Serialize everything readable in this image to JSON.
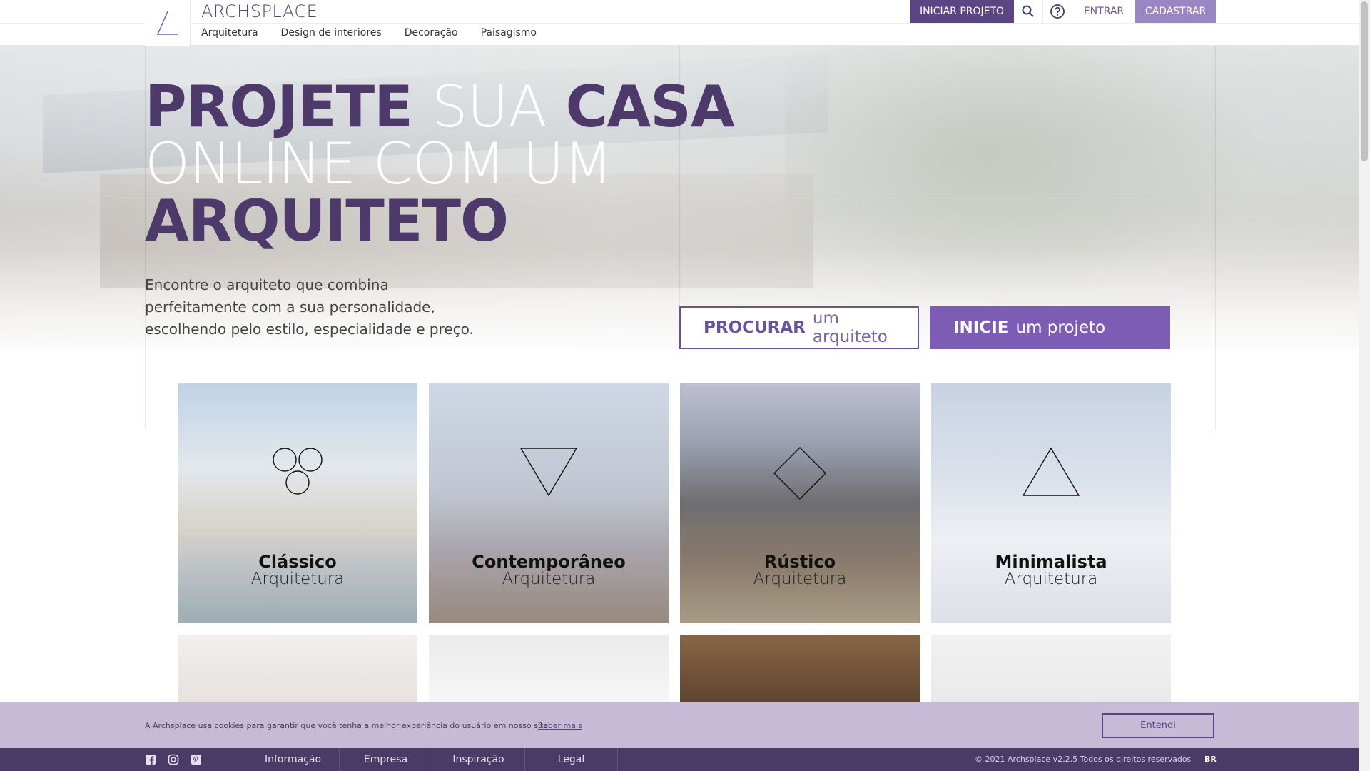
{
  "header": {
    "brand": "ARCHSPLACE",
    "logo_icon": "triangle-logo-icon",
    "nav": [
      "Arquitetura",
      "Design de interiores",
      "Decoração",
      "Paisagismo"
    ],
    "start_project": "INICIAR PROJETO",
    "search_icon": "search-icon",
    "help_icon": "help-icon",
    "login": "ENTRAR",
    "register": "CADASTRAR"
  },
  "hero": {
    "headline": {
      "w1": "PROJETE",
      "w2": "SUA",
      "w3": "CASA",
      "line2": "ONLINE COM UM",
      "line3": "ARQUITETO"
    },
    "tagline": "Encontre o arquiteto que combina perfeitamente com a sua personalidade, escolhendo pelo estilo, especialidade e preço.",
    "cta_search": {
      "strong": "PROCURAR",
      "light": "um arquiteto"
    },
    "cta_start": {
      "strong": "INICIE",
      "light": "um projeto"
    }
  },
  "styles": [
    {
      "title": "Clássico",
      "subtitle": "Arquitetura",
      "icon": "three-circles-icon"
    },
    {
      "title": "Contemporâneo",
      "subtitle": "Arquitetura",
      "icon": "inverted-triangle-icon"
    },
    {
      "title": "Rústico",
      "subtitle": "Arquitetura",
      "icon": "diamond-icon"
    },
    {
      "title": "Minimalista",
      "subtitle": "Arquitetura",
      "icon": "triangle-icon"
    }
  ],
  "cookie": {
    "message": "A Archsplace usa cookies para garantir que você tenha a melhor experiência do usuário em nosso site.",
    "more": "Saber mais",
    "ok": "Entendi"
  },
  "footer": {
    "social": [
      "facebook-icon",
      "instagram-icon",
      "pinterest-icon"
    ],
    "links": [
      "Informação",
      "Empresa",
      "Inspiração",
      "Legal"
    ],
    "copyright": "© 2021 Archsplace v2.2.5 Todos os direitos reservados",
    "lang": "BR"
  },
  "colors": {
    "brand_purple": "#5b4683",
    "accent_purple": "#7c5cb5",
    "light_purple": "#9b86c4",
    "footer_bg": "#4a3a66"
  }
}
